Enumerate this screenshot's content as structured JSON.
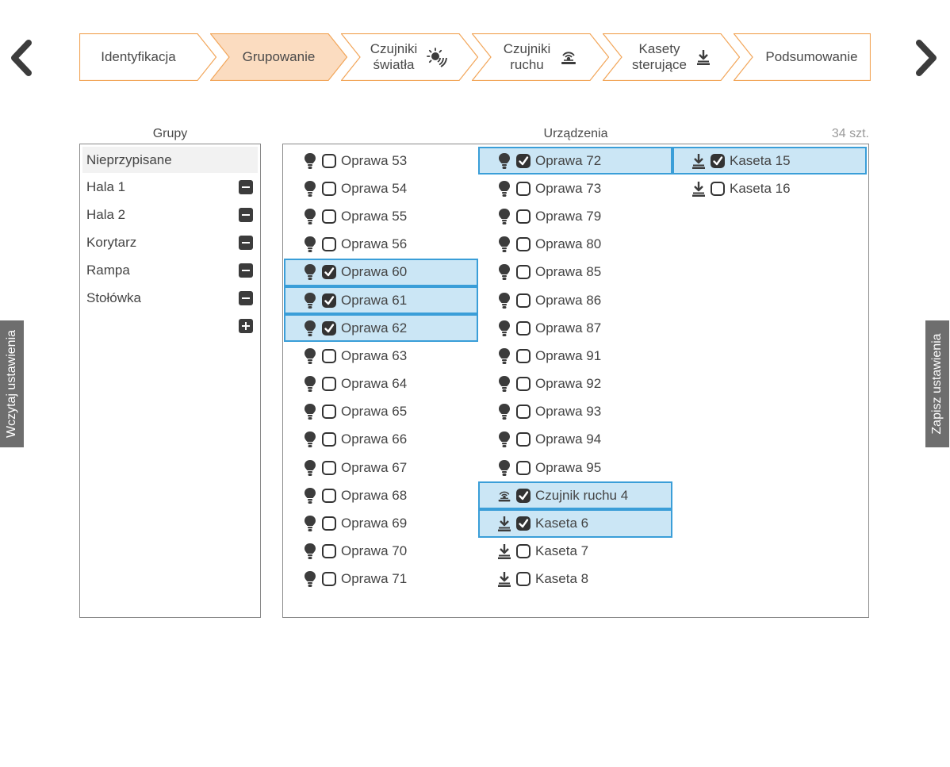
{
  "nav": {
    "prev_icon": "chevron-left-icon",
    "next_icon": "chevron-right-icon"
  },
  "wizard": {
    "steps": [
      {
        "label": "Identyfikacja",
        "icon": "",
        "active": false
      },
      {
        "label": "Grupowanie",
        "icon": "",
        "active": true
      },
      {
        "label": "Czujniki\nświatła",
        "icon": "light-sensor-icon",
        "active": false
      },
      {
        "label": "Czujniki\nruchu",
        "icon": "motion-sensor-icon",
        "active": false
      },
      {
        "label": "Kasety\nsterujące",
        "icon": "cassette-icon",
        "active": false
      },
      {
        "label": "Podsumowanie",
        "icon": "",
        "active": false
      }
    ],
    "colors": {
      "border": "#f2a65a",
      "active_fill": "#fbdcc0"
    }
  },
  "side": {
    "load_label": "Wczytaj ustawienia",
    "save_label": "Zapisz ustawienia"
  },
  "groups": {
    "title": "Grupy",
    "items": [
      {
        "label": "Nieprzypisane",
        "removable": false,
        "selected": true
      },
      {
        "label": "Hala 1",
        "removable": true,
        "selected": false
      },
      {
        "label": "Hala 2",
        "removable": true,
        "selected": false
      },
      {
        "label": "Korytarz",
        "removable": true,
        "selected": false
      },
      {
        "label": "Rampa",
        "removable": true,
        "selected": false
      },
      {
        "label": "Stołówka",
        "removable": true,
        "selected": false
      }
    ]
  },
  "devices": {
    "title": "Urządzenia",
    "count": "34 szt.",
    "selected_color": "#cbe6f5",
    "columns": [
      [
        {
          "type": "lamp",
          "label": "Oprawa 53",
          "checked": false
        },
        {
          "type": "lamp",
          "label": "Oprawa 54",
          "checked": false
        },
        {
          "type": "lamp",
          "label": "Oprawa 55",
          "checked": false
        },
        {
          "type": "lamp",
          "label": "Oprawa 56",
          "checked": false
        },
        {
          "type": "lamp",
          "label": "Oprawa 60",
          "checked": true
        },
        {
          "type": "lamp",
          "label": "Oprawa 61",
          "checked": true
        },
        {
          "type": "lamp",
          "label": "Oprawa 62",
          "checked": true
        },
        {
          "type": "lamp",
          "label": "Oprawa 63",
          "checked": false
        },
        {
          "type": "lamp",
          "label": "Oprawa 64",
          "checked": false
        },
        {
          "type": "lamp",
          "label": "Oprawa 65",
          "checked": false
        },
        {
          "type": "lamp",
          "label": "Oprawa 66",
          "checked": false
        },
        {
          "type": "lamp",
          "label": "Oprawa 67",
          "checked": false
        },
        {
          "type": "lamp",
          "label": "Oprawa 68",
          "checked": false
        },
        {
          "type": "lamp",
          "label": "Oprawa 69",
          "checked": false
        },
        {
          "type": "lamp",
          "label": "Oprawa 70",
          "checked": false
        },
        {
          "type": "lamp",
          "label": "Oprawa 71",
          "checked": false
        }
      ],
      [
        {
          "type": "lamp",
          "label": "Oprawa 72",
          "checked": true
        },
        {
          "type": "lamp",
          "label": "Oprawa 73",
          "checked": false
        },
        {
          "type": "lamp",
          "label": "Oprawa 79",
          "checked": false
        },
        {
          "type": "lamp",
          "label": "Oprawa 80",
          "checked": false
        },
        {
          "type": "lamp",
          "label": "Oprawa 85",
          "checked": false
        },
        {
          "type": "lamp",
          "label": "Oprawa 86",
          "checked": false
        },
        {
          "type": "lamp",
          "label": "Oprawa 87",
          "checked": false
        },
        {
          "type": "lamp",
          "label": "Oprawa 91",
          "checked": false
        },
        {
          "type": "lamp",
          "label": "Oprawa 92",
          "checked": false
        },
        {
          "type": "lamp",
          "label": "Oprawa 93",
          "checked": false
        },
        {
          "type": "lamp",
          "label": "Oprawa 94",
          "checked": false
        },
        {
          "type": "lamp",
          "label": "Oprawa 95",
          "checked": false
        },
        {
          "type": "motion",
          "label": "Czujnik ruchu 4",
          "checked": true
        },
        {
          "type": "cassette",
          "label": "Kaseta 6",
          "checked": true
        },
        {
          "type": "cassette",
          "label": "Kaseta 7",
          "checked": false
        },
        {
          "type": "cassette",
          "label": "Kaseta 8",
          "checked": false
        }
      ],
      [
        {
          "type": "cassette",
          "label": "Kaseta 15",
          "checked": true
        },
        {
          "type": "cassette",
          "label": "Kaseta 16",
          "checked": false
        }
      ]
    ]
  }
}
